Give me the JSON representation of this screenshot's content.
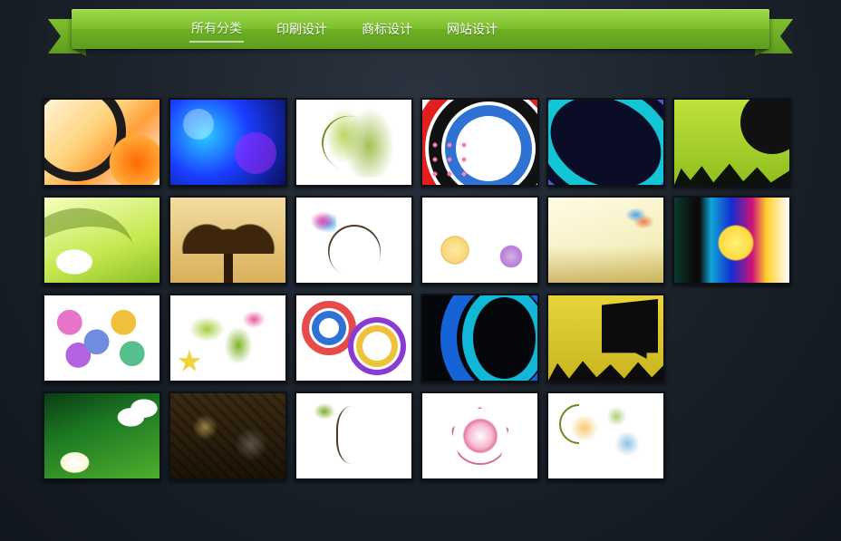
{
  "nav": {
    "items": [
      {
        "label": "所有分类",
        "active": true
      },
      {
        "label": "印刷设计",
        "active": false
      },
      {
        "label": "商标设计",
        "active": false
      },
      {
        "label": "网站设计",
        "active": false
      }
    ]
  },
  "gallery": {
    "rows": [
      [
        "abstract-orange-rings",
        "blue-bokeh-swirl",
        "green-floral-scroll",
        "concentric-rainbow-circles",
        "purple-teal-arcs",
        "olive-silhouette-splatter"
      ],
      [
        "green-wave-lily",
        "bonsai-sepia",
        "pastel-swirl-flowers",
        "soft-rose-blossoms",
        "butterfly-cream",
        "rainbow-stripe-lotus"
      ],
      [
        "paisley-multicolor-drops",
        "green-floral-burst",
        "rainbow-ring-cluster",
        "navy-blue-arcs",
        "yellow-city-silhouette"
      ],
      [
        "frangipani-green",
        "grunge-sepia-texture",
        "brown-vine-leaves",
        "pink-line-roses",
        "watercolor-orange-blue"
      ]
    ]
  }
}
